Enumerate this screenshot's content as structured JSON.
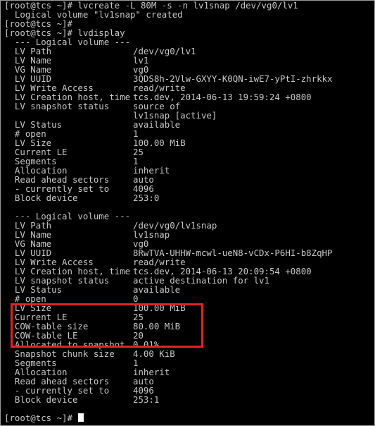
{
  "colors": {
    "background": "#000000",
    "text": "#c8c8c8",
    "highlight": "#e32222",
    "cursor": "#ffffff"
  },
  "terminal": {
    "lines": [
      {
        "type": "raw",
        "text": "[root@tcs ~]# lvcreate -L 80M -s -n lv1snap /dev/vg0/lv1"
      },
      {
        "type": "raw",
        "text": "  Logical volume \"lv1snap\" created"
      },
      {
        "type": "raw",
        "text": "[root@tcs ~]#"
      },
      {
        "type": "raw",
        "text": "[root@tcs ~]# lvdisplay"
      },
      {
        "type": "raw",
        "text": "  --- Logical volume ---"
      },
      {
        "type": "kv",
        "key": "  LV Path",
        "value": "/dev/vg0/lv1"
      },
      {
        "type": "kv",
        "key": "  LV Name",
        "value": "lv1"
      },
      {
        "type": "kv",
        "key": "  VG Name",
        "value": "vg0"
      },
      {
        "type": "kv",
        "key": "  LV UUID",
        "value": "3QDS8h-2Vlw-GXYY-K0QN-iwE7-yPtI-zhrkkx"
      },
      {
        "type": "kv",
        "key": "  LV Write Access",
        "value": "read/write"
      },
      {
        "type": "kv",
        "key": "  LV Creation host, time",
        "value": "tcs.dev, 2014-06-13 19:59:24 +0800"
      },
      {
        "type": "kv",
        "key": "  LV snapshot status",
        "value": "source of"
      },
      {
        "type": "kv",
        "key": "",
        "value": "lv1snap [active]"
      },
      {
        "type": "kv",
        "key": "  LV Status",
        "value": "available"
      },
      {
        "type": "kv",
        "key": "  # open",
        "value": "1"
      },
      {
        "type": "kv",
        "key": "  LV Size",
        "value": "100.00 MiB"
      },
      {
        "type": "kv",
        "key": "  Current LE",
        "value": "25"
      },
      {
        "type": "kv",
        "key": "  Segments",
        "value": "1"
      },
      {
        "type": "kv",
        "key": "  Allocation",
        "value": "inherit"
      },
      {
        "type": "kv",
        "key": "  Read ahead sectors",
        "value": "auto"
      },
      {
        "type": "kv",
        "key": "  - currently set to",
        "value": "4096"
      },
      {
        "type": "kv",
        "key": "  Block device",
        "value": "253:0"
      },
      {
        "type": "raw",
        "text": ""
      },
      {
        "type": "raw",
        "text": "  --- Logical volume ---"
      },
      {
        "type": "kv",
        "key": "  LV Path",
        "value": "/dev/vg0/lv1snap"
      },
      {
        "type": "kv",
        "key": "  LV Name",
        "value": "lv1snap"
      },
      {
        "type": "kv",
        "key": "  VG Name",
        "value": "vg0"
      },
      {
        "type": "kv",
        "key": "  LV UUID",
        "value": "8RwTVA-UHHW-mcwl-ueN8-vCDx-P6HI-b8ZqHP"
      },
      {
        "type": "kv",
        "key": "  LV Write Access",
        "value": "read/write"
      },
      {
        "type": "kv",
        "key": "  LV Creation host, time",
        "value": "tcs.dev, 2014-06-13 20:09:54 +0800"
      },
      {
        "type": "kv",
        "key": "  LV snapshot status",
        "value": "active destination for lv1"
      },
      {
        "type": "kv",
        "key": "  LV Status",
        "value": "available"
      },
      {
        "type": "kv",
        "key": "  # open",
        "value": "0"
      },
      {
        "type": "kv",
        "key": "  LV Size",
        "value": "100.00 MiB"
      },
      {
        "type": "kv",
        "key": "  Current LE",
        "value": "25"
      },
      {
        "type": "kv",
        "key": "  COW-table size",
        "value": "80.00 MiB"
      },
      {
        "type": "kv",
        "key": "  COW-table LE",
        "value": "20"
      },
      {
        "type": "kv",
        "key": "  Allocated to snapshot",
        "value": "0.01%"
      },
      {
        "type": "kv",
        "key": "  Snapshot chunk size",
        "value": "4.00 KiB"
      },
      {
        "type": "kv",
        "key": "  Segments",
        "value": "1"
      },
      {
        "type": "kv",
        "key": "  Allocation",
        "value": "inherit"
      },
      {
        "type": "kv",
        "key": "  Read ahead sectors",
        "value": "auto"
      },
      {
        "type": "kv",
        "key": "  - currently set to",
        "value": "4096"
      },
      {
        "type": "kv",
        "key": "  Block device",
        "value": "253:1"
      },
      {
        "type": "raw",
        "text": ""
      },
      {
        "type": "raw",
        "text": "[root@tcs ~]# "
      }
    ]
  }
}
